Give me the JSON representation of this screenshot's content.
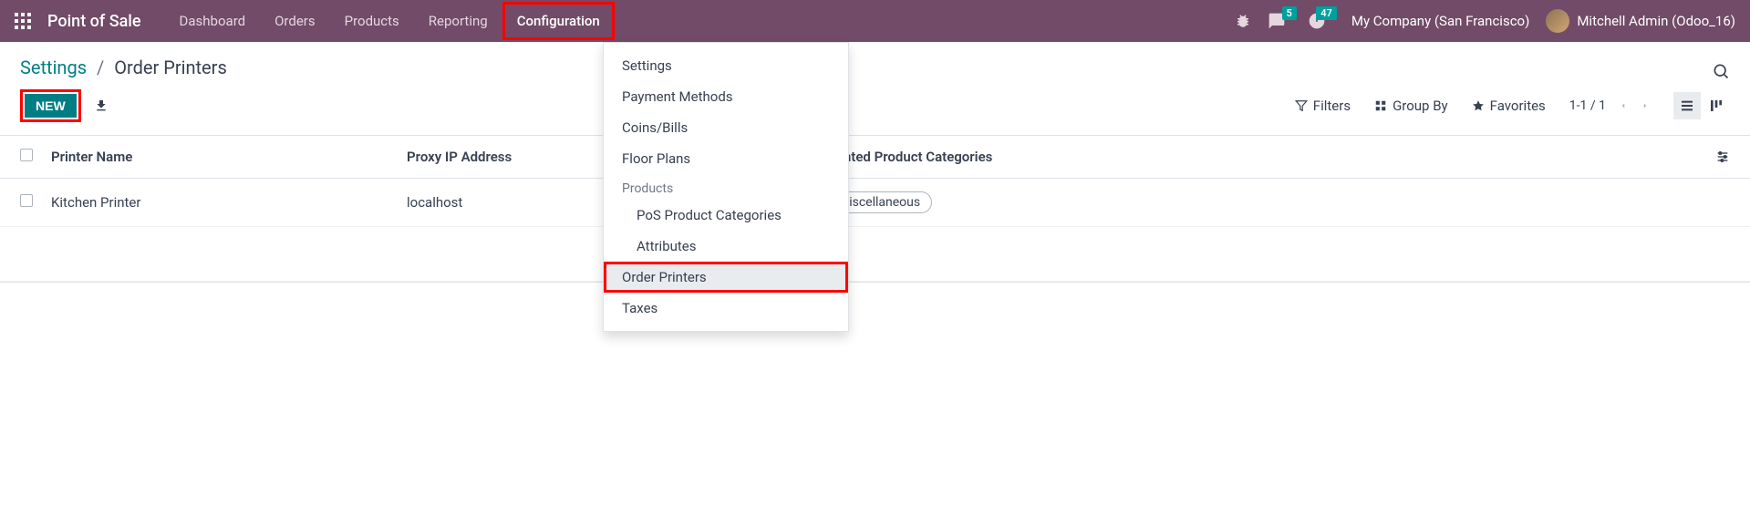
{
  "navbar": {
    "brand": "Point of Sale",
    "items": [
      "Dashboard",
      "Orders",
      "Products",
      "Reporting",
      "Configuration"
    ],
    "highlighted_index": 4,
    "messages_count": "5",
    "activities_count": "47",
    "company": "My Company (San Francisco)",
    "user": "Mitchell Admin (Odoo_16)"
  },
  "dropdown": {
    "items": [
      "Settings",
      "Payment Methods",
      "Coins/Bills",
      "Floor Plans"
    ],
    "products_header": "Products",
    "products_sub": [
      "PoS Product Categories",
      "Attributes"
    ],
    "order_printers": "Order Printers",
    "taxes": "Taxes"
  },
  "breadcrumb": {
    "parent": "Settings",
    "current": "Order Printers"
  },
  "toolbar": {
    "new_label": "NEW",
    "filters": "Filters",
    "group_by": "Group By",
    "favorites": "Favorites",
    "pager": "1-1 / 1"
  },
  "table": {
    "headers": {
      "name": "Printer Name",
      "proxy": "Proxy IP Address",
      "categories": "Printed Product Categories"
    },
    "rows": [
      {
        "name": "Kitchen Printer",
        "proxy": "localhost",
        "category_tag": "Miscellaneous"
      }
    ]
  }
}
